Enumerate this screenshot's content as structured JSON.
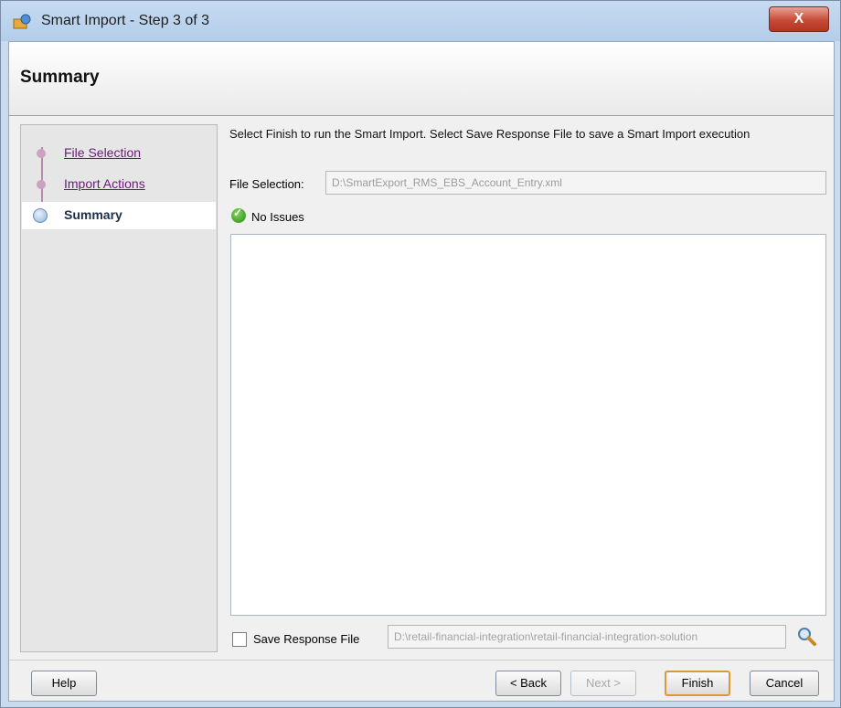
{
  "window": {
    "title": "Smart Import - Step 3 of 3",
    "close_label": "X"
  },
  "header": {
    "title": "Summary"
  },
  "nav": {
    "items": [
      {
        "label": "File Selection",
        "state": "visited"
      },
      {
        "label": "Import Actions",
        "state": "visited"
      },
      {
        "label": "Summary",
        "state": "current"
      }
    ]
  },
  "content": {
    "description": "Select Finish to run the Smart Import. Select Save Response File to save a Smart Import execution",
    "file_selection_label": "File Selection:",
    "file_selection_value": "D:\\SmartExport_RMS_EBS_Account_Entry.xml",
    "issues_status": "No Issues",
    "save_response_label": "Save Response File",
    "save_response_checked": false,
    "save_response_path": "D:\\retail-financial-integration\\retail-financial-integration-solution"
  },
  "footer": {
    "help_label": "Help",
    "back_label": "< Back",
    "next_label": "Next >",
    "finish_label": "Finish",
    "cancel_label": "Cancel"
  },
  "colors": {
    "nav_link": "#6b1a7a",
    "accent_default_button": "#d99b3a",
    "status_ok": "#2f8a17"
  }
}
